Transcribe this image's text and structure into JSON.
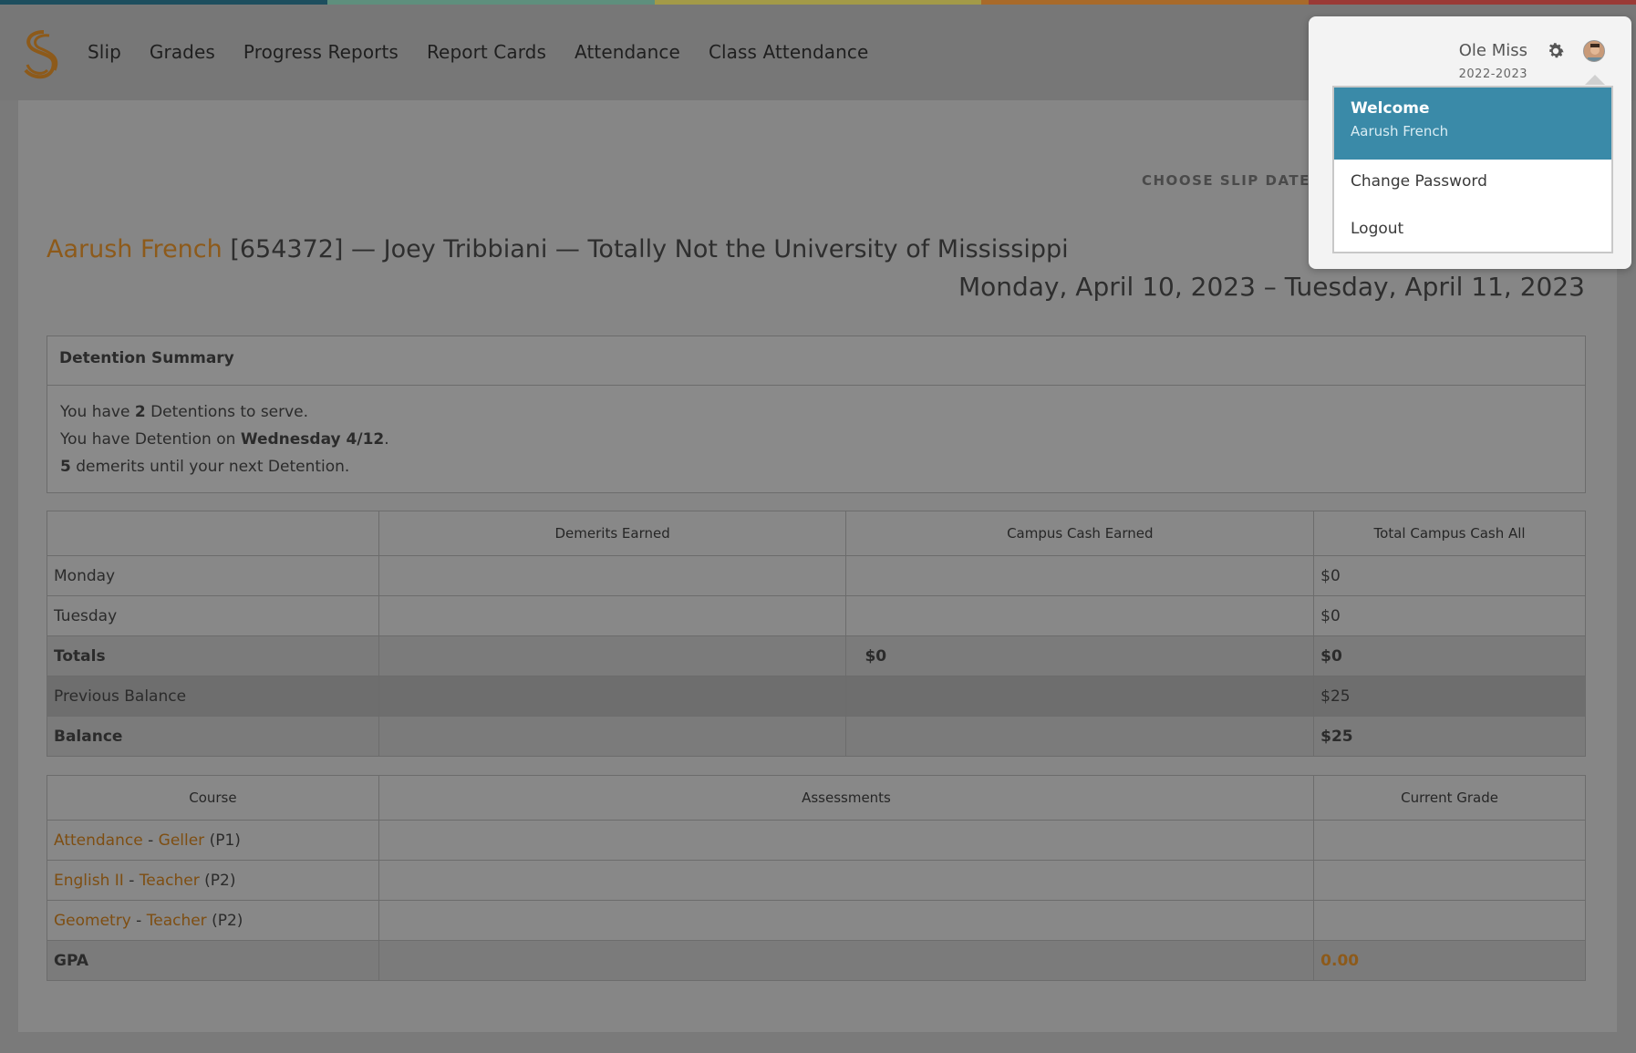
{
  "nav": {
    "items": [
      "Slip",
      "Grades",
      "Progress Reports",
      "Report Cards",
      "Attendance",
      "Class Attendance"
    ]
  },
  "slip_date": {
    "label": "CHOOSE SLIP DATE"
  },
  "header": {
    "student_name": "Aarush French",
    "rest": " [654372] — Joey Tribbiani — Totally Not the University of Mississippi",
    "date_range": "Monday, April 10, 2023 – Tuesday, April 11, 2023"
  },
  "detention": {
    "title": "Detention Summary",
    "line1_pre": "You have ",
    "line1_num": "2",
    "line1_post": " Detentions to serve.",
    "line2_pre": "You have Detention on ",
    "line2_day": "Wednesday 4/12",
    "line2_post": ".",
    "line3_num": "5",
    "line3_post": " demerits until your next Detention."
  },
  "behavior_table": {
    "headers": [
      "",
      "Demerits Earned",
      "Campus Cash Earned",
      "Total Campus Cash All"
    ],
    "rows": [
      {
        "label": "Monday",
        "demerits": "",
        "cash": "",
        "total": "$0"
      },
      {
        "label": "Tuesday",
        "demerits": "",
        "cash": "",
        "total": "$0"
      },
      {
        "label": "Totals",
        "demerits": "",
        "cash": "$0",
        "total": "$0"
      },
      {
        "label": "Previous Balance",
        "demerits": "",
        "cash": "",
        "total": "$25"
      },
      {
        "label": "Balance",
        "demerits": "",
        "cash": "",
        "total": "$25"
      }
    ]
  },
  "course_table": {
    "headers": [
      "Course",
      "Assessments",
      "Current Grade"
    ],
    "rows": [
      {
        "course": "Attendance",
        "sep": " - ",
        "teacher": "Geller",
        "period": " (P1)"
      },
      {
        "course": "English II",
        "sep": " - ",
        "teacher": "Teacher",
        "period": " (P2)"
      },
      {
        "course": "Geometry",
        "sep": " - ",
        "teacher": "Teacher",
        "period": " (P2)"
      }
    ],
    "gpa_label": "GPA",
    "gpa_value": "0.00"
  },
  "user_menu": {
    "school": "Ole Miss",
    "year": "2022-2023",
    "welcome": "Welcome",
    "user": "Aarush French",
    "change_password": "Change Password",
    "logout": "Logout"
  }
}
